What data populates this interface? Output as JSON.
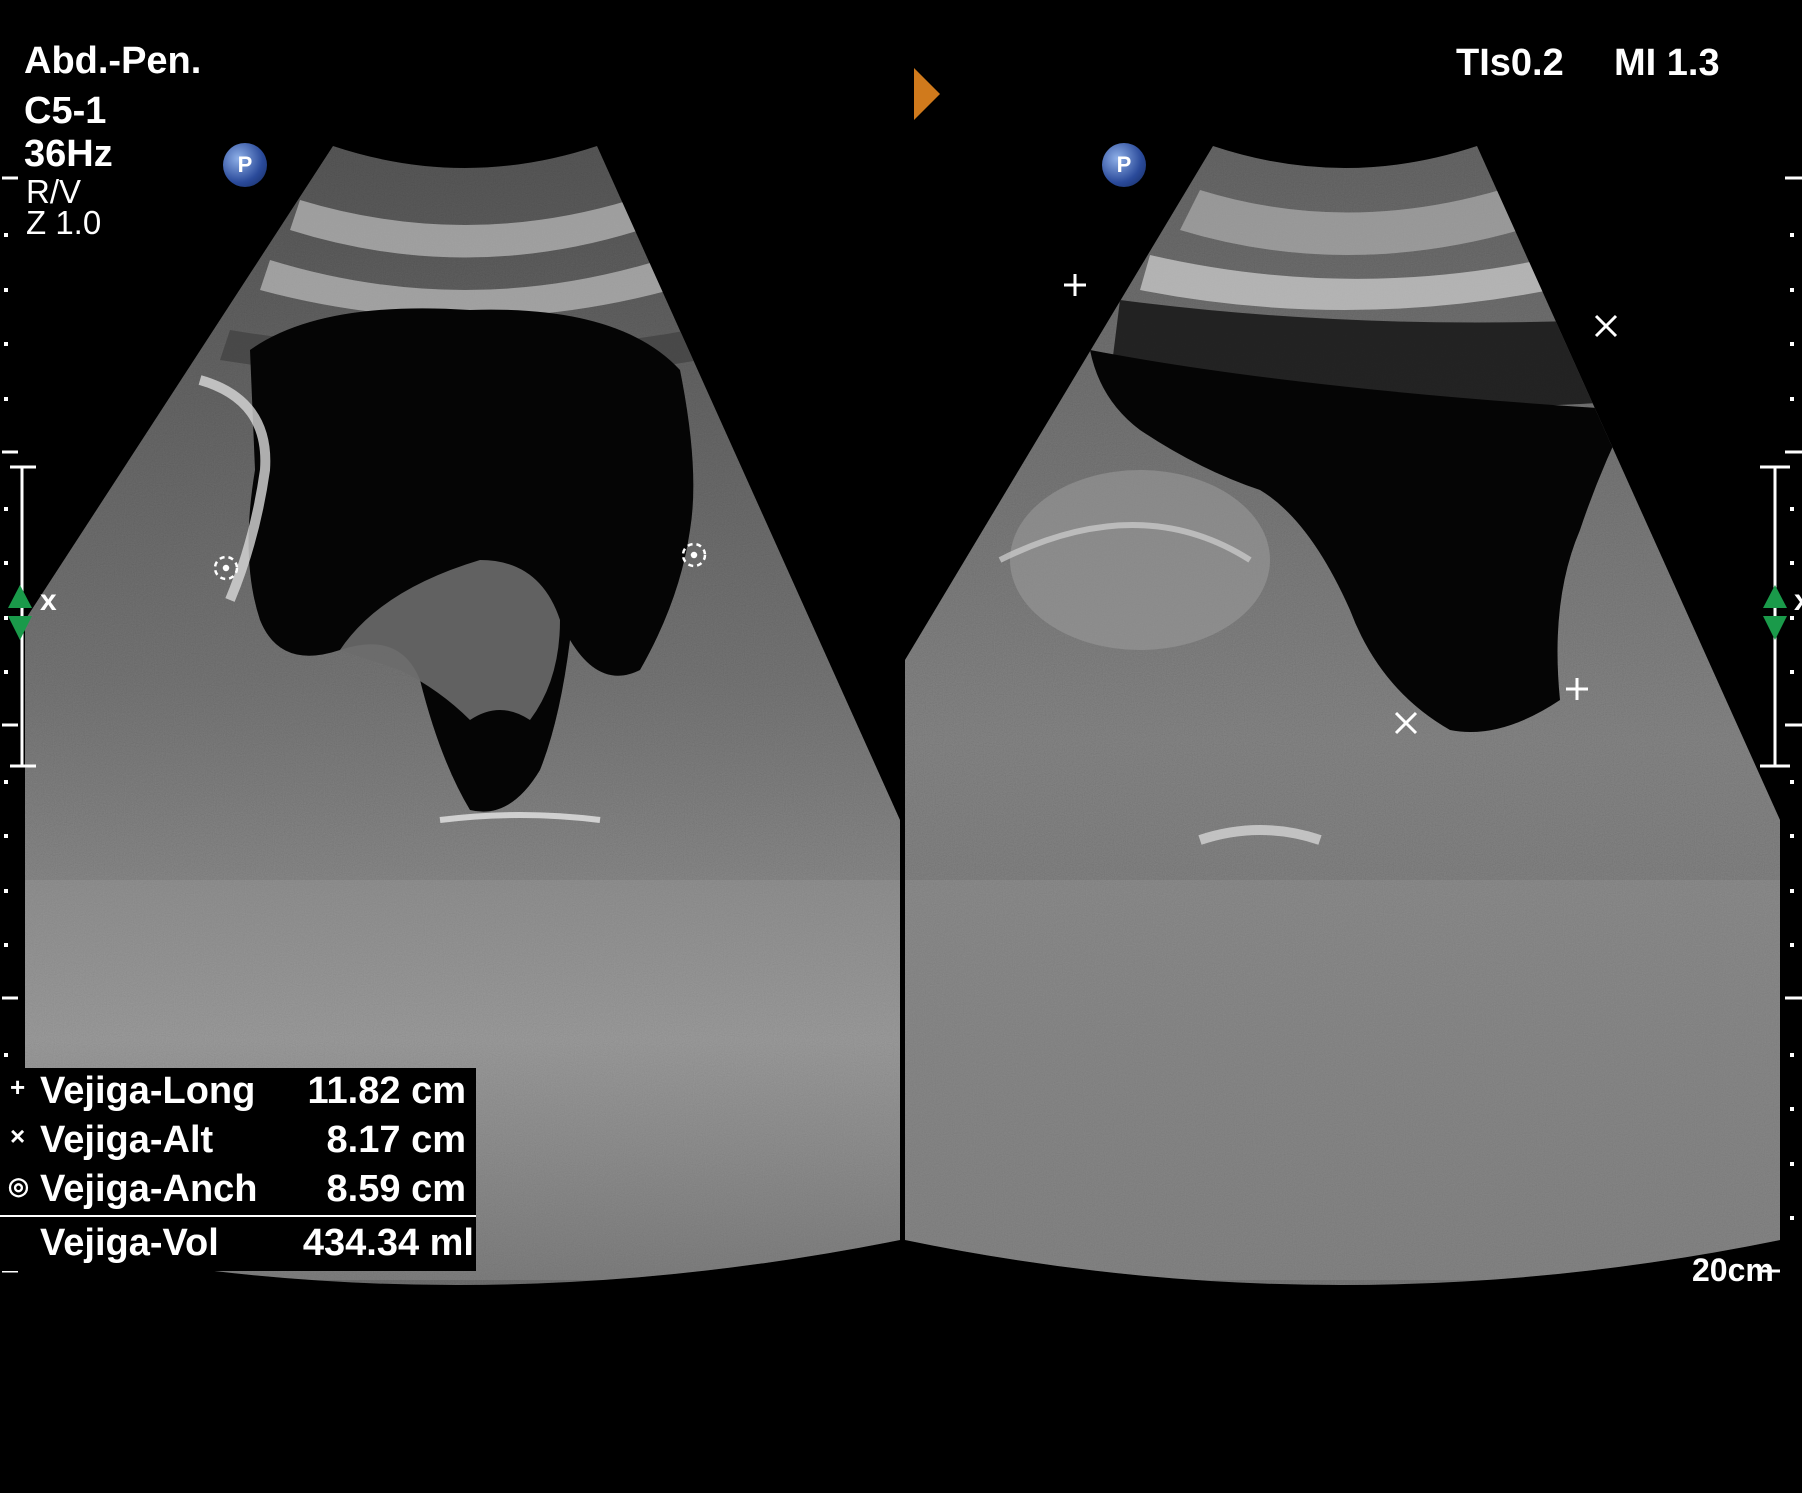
{
  "header": {
    "preset": "Abd.-Pen.",
    "probe": "C5-1",
    "frame_rate": "36Hz",
    "orientation": "R/V",
    "zoom": "Z 1.0",
    "tis": "TIs0.2",
    "mi": "MI 1.3",
    "depth": "20cm",
    "focus_marker": "x"
  },
  "icons": {
    "left_probe_mark": "P",
    "right_probe_mark": "P"
  },
  "measurements": [
    {
      "symbol": "+",
      "name": "Vejiga-Long",
      "value": "11.82 cm"
    },
    {
      "symbol": "×",
      "name": "Vejiga-Alt",
      "value": "8.17 cm"
    },
    {
      "symbol": "◎",
      "name": "Vejiga-Anch",
      "value": "8.59 cm"
    }
  ],
  "volume": {
    "name": "Vejiga-Vol",
    "value": "434.34 ml"
  },
  "colors": {
    "background": "#000000",
    "orientation_marker": "#d07a1c",
    "focus_marker": "#1a9a4a"
  }
}
